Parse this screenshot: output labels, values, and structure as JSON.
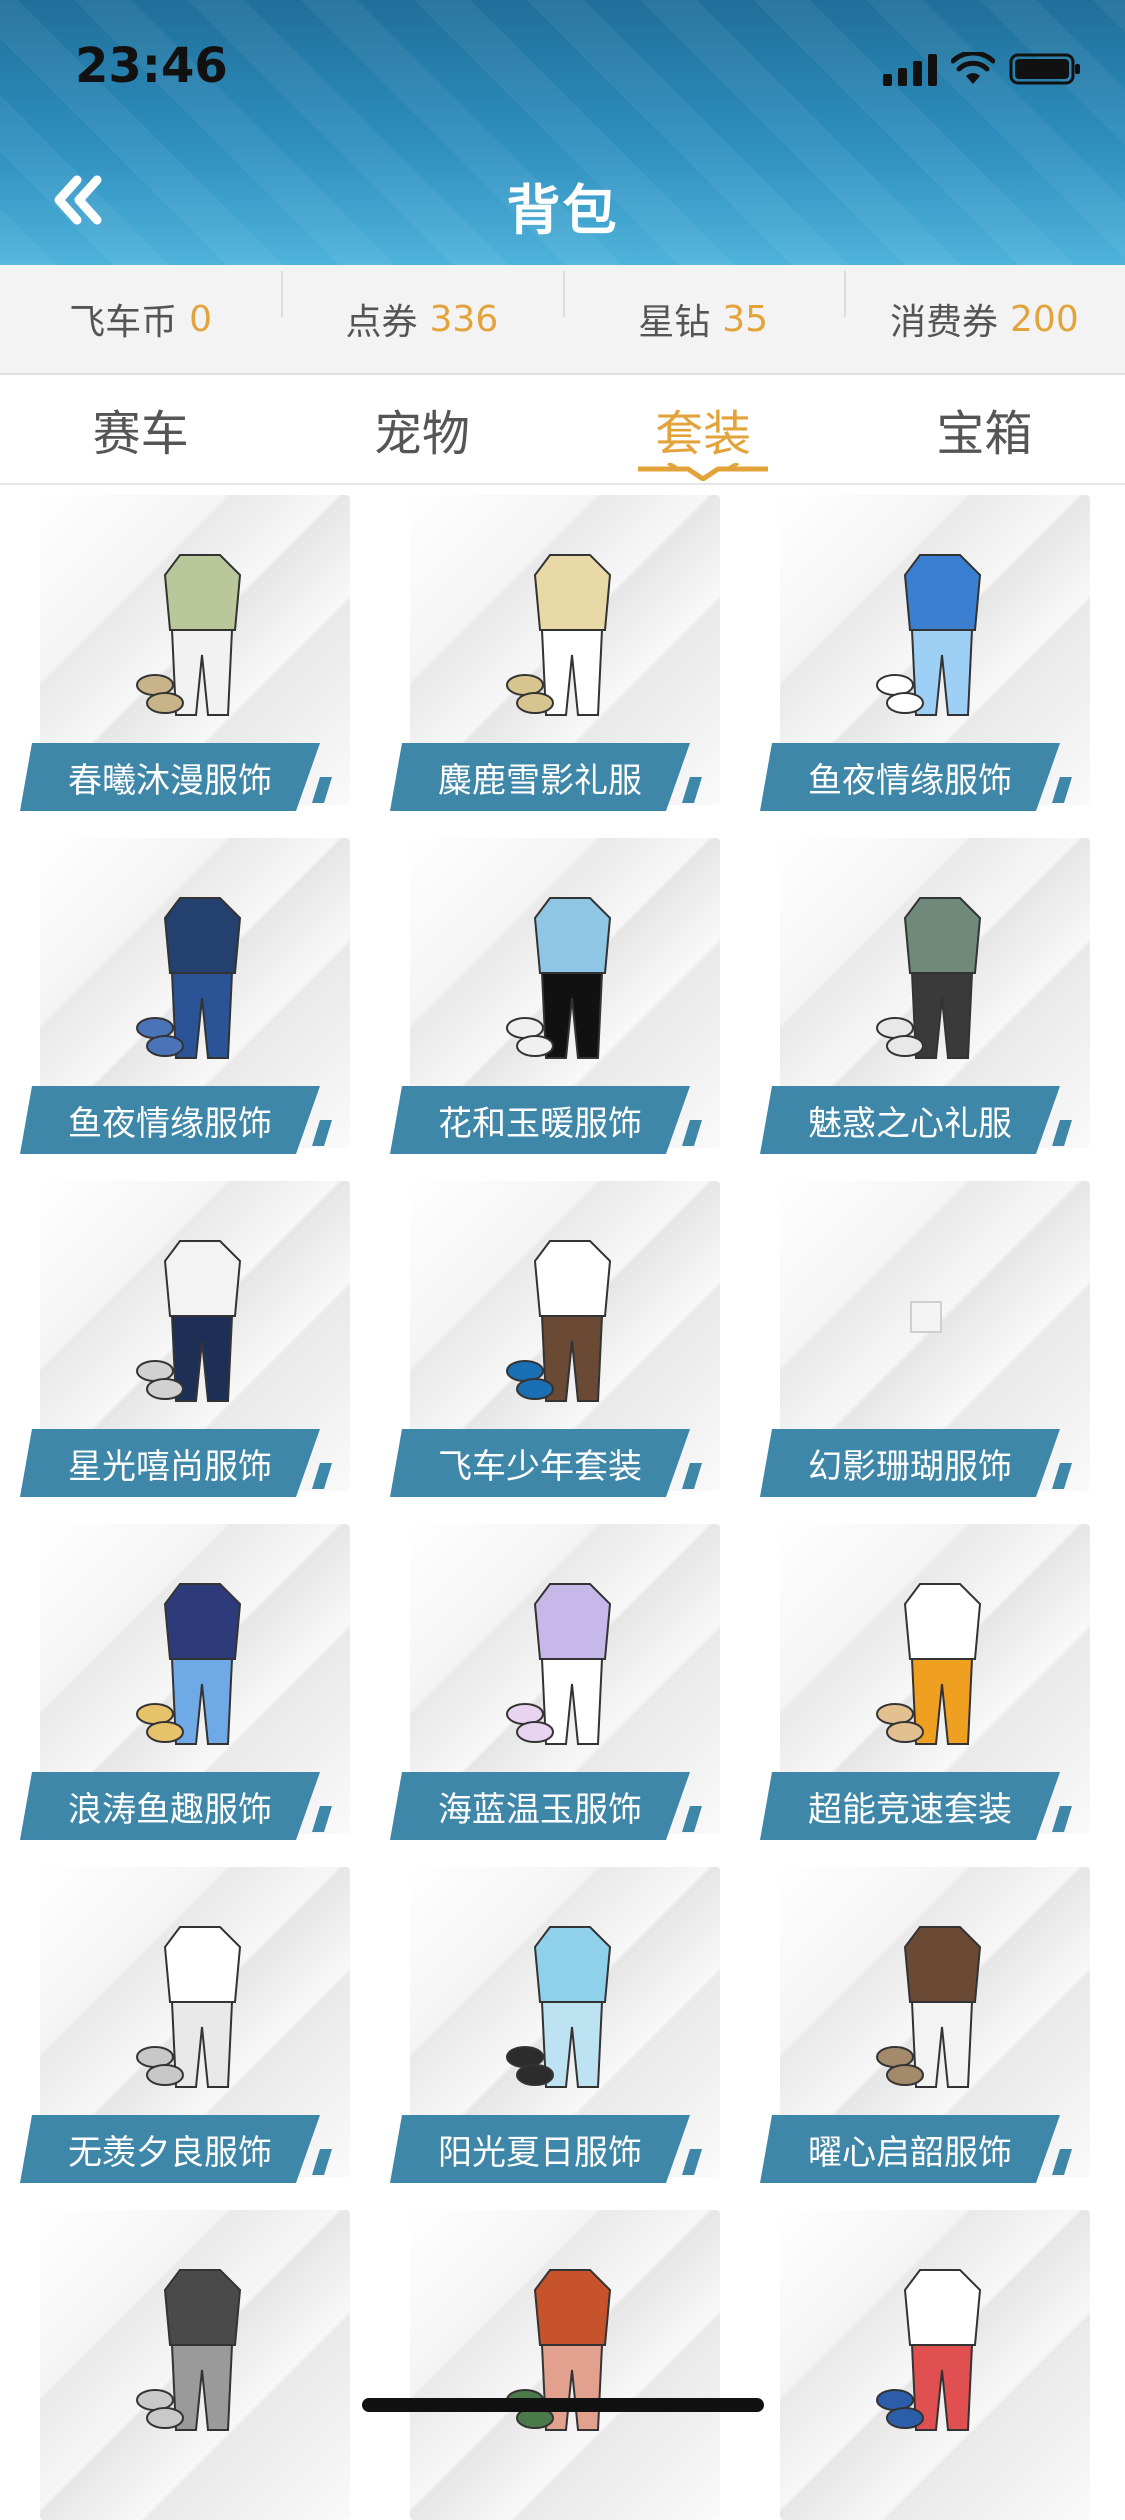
{
  "status": {
    "time": "23:46"
  },
  "header": {
    "title": "背包"
  },
  "currencies": [
    {
      "label": "飞车币",
      "value": "0"
    },
    {
      "label": "点券",
      "value": "336"
    },
    {
      "label": "星钻",
      "value": "35"
    },
    {
      "label": "消费券",
      "value": "200"
    }
  ],
  "tabs": [
    {
      "label": "赛车",
      "active": false
    },
    {
      "label": "宠物",
      "active": false
    },
    {
      "label": "套装",
      "active": true
    },
    {
      "label": "宝箱",
      "active": false
    }
  ],
  "colors": {
    "accent": "#e3a33b",
    "label_bg": "#3f87a8",
    "header": "#2f8fbf"
  },
  "items": [
    {
      "name": "春曦沐漫服饰",
      "palette": [
        "#b9c79a",
        "#f2f2f2",
        "#c9b48a"
      ]
    },
    {
      "name": "麋鹿雪影礼服",
      "palette": [
        "#e9d9a7",
        "#ffffff",
        "#d8c48f"
      ]
    },
    {
      "name": "鱼夜情缘服饰",
      "palette": [
        "#3b7fd1",
        "#9ed0f5",
        "#ffffff"
      ]
    },
    {
      "name": "鱼夜情缘服饰",
      "palette": [
        "#23406f",
        "#2b5496",
        "#4a73b8"
      ]
    },
    {
      "name": "花和玉暖服饰",
      "palette": [
        "#8fc6e6",
        "#111111",
        "#f0f0f0"
      ]
    },
    {
      "name": "魅惑之心礼服",
      "palette": [
        "#6f8a7a",
        "#3a3a3a",
        "#e8e8e8"
      ]
    },
    {
      "name": "星光嘻尚服饰",
      "palette": [
        "#f3f3f3",
        "#1e2f55",
        "#d1d1d1"
      ]
    },
    {
      "name": "飞车少年套装",
      "palette": [
        "#ffffff",
        "#6b4a35",
        "#1a6fb3"
      ]
    },
    {
      "name": "幻影珊瑚服饰",
      "palette": []
    },
    {
      "name": "浪涛鱼趣服饰",
      "palette": [
        "#2d3b7a",
        "#6fa9e6",
        "#e6c36a"
      ]
    },
    {
      "name": "海蓝温玉服饰",
      "palette": [
        "#c6b9ea",
        "#ffffff",
        "#e8d4f0"
      ]
    },
    {
      "name": "超能竞速套装",
      "palette": [
        "#ffffff",
        "#f0a020",
        "#e2c08f"
      ]
    },
    {
      "name": "无羡夕良服饰",
      "palette": [
        "#ffffff",
        "#e9e9e9",
        "#c8c8c8"
      ]
    },
    {
      "name": "阳光夏日服饰",
      "palette": [
        "#8fd0ea",
        "#bde3f2",
        "#2c2c2c"
      ]
    },
    {
      "name": "曜心启韶服饰",
      "palette": [
        "#6b4a35",
        "#f3f3f3",
        "#a38a6a"
      ]
    },
    {
      "name": "",
      "palette": [
        "#4a4a4a",
        "#9a9a9a",
        "#c9c9c9"
      ]
    },
    {
      "name": "",
      "palette": [
        "#c7532c",
        "#e2a18f",
        "#4a7a4a"
      ]
    },
    {
      "name": "",
      "palette": [
        "#ffffff",
        "#e05050",
        "#2b5da8"
      ]
    }
  ]
}
